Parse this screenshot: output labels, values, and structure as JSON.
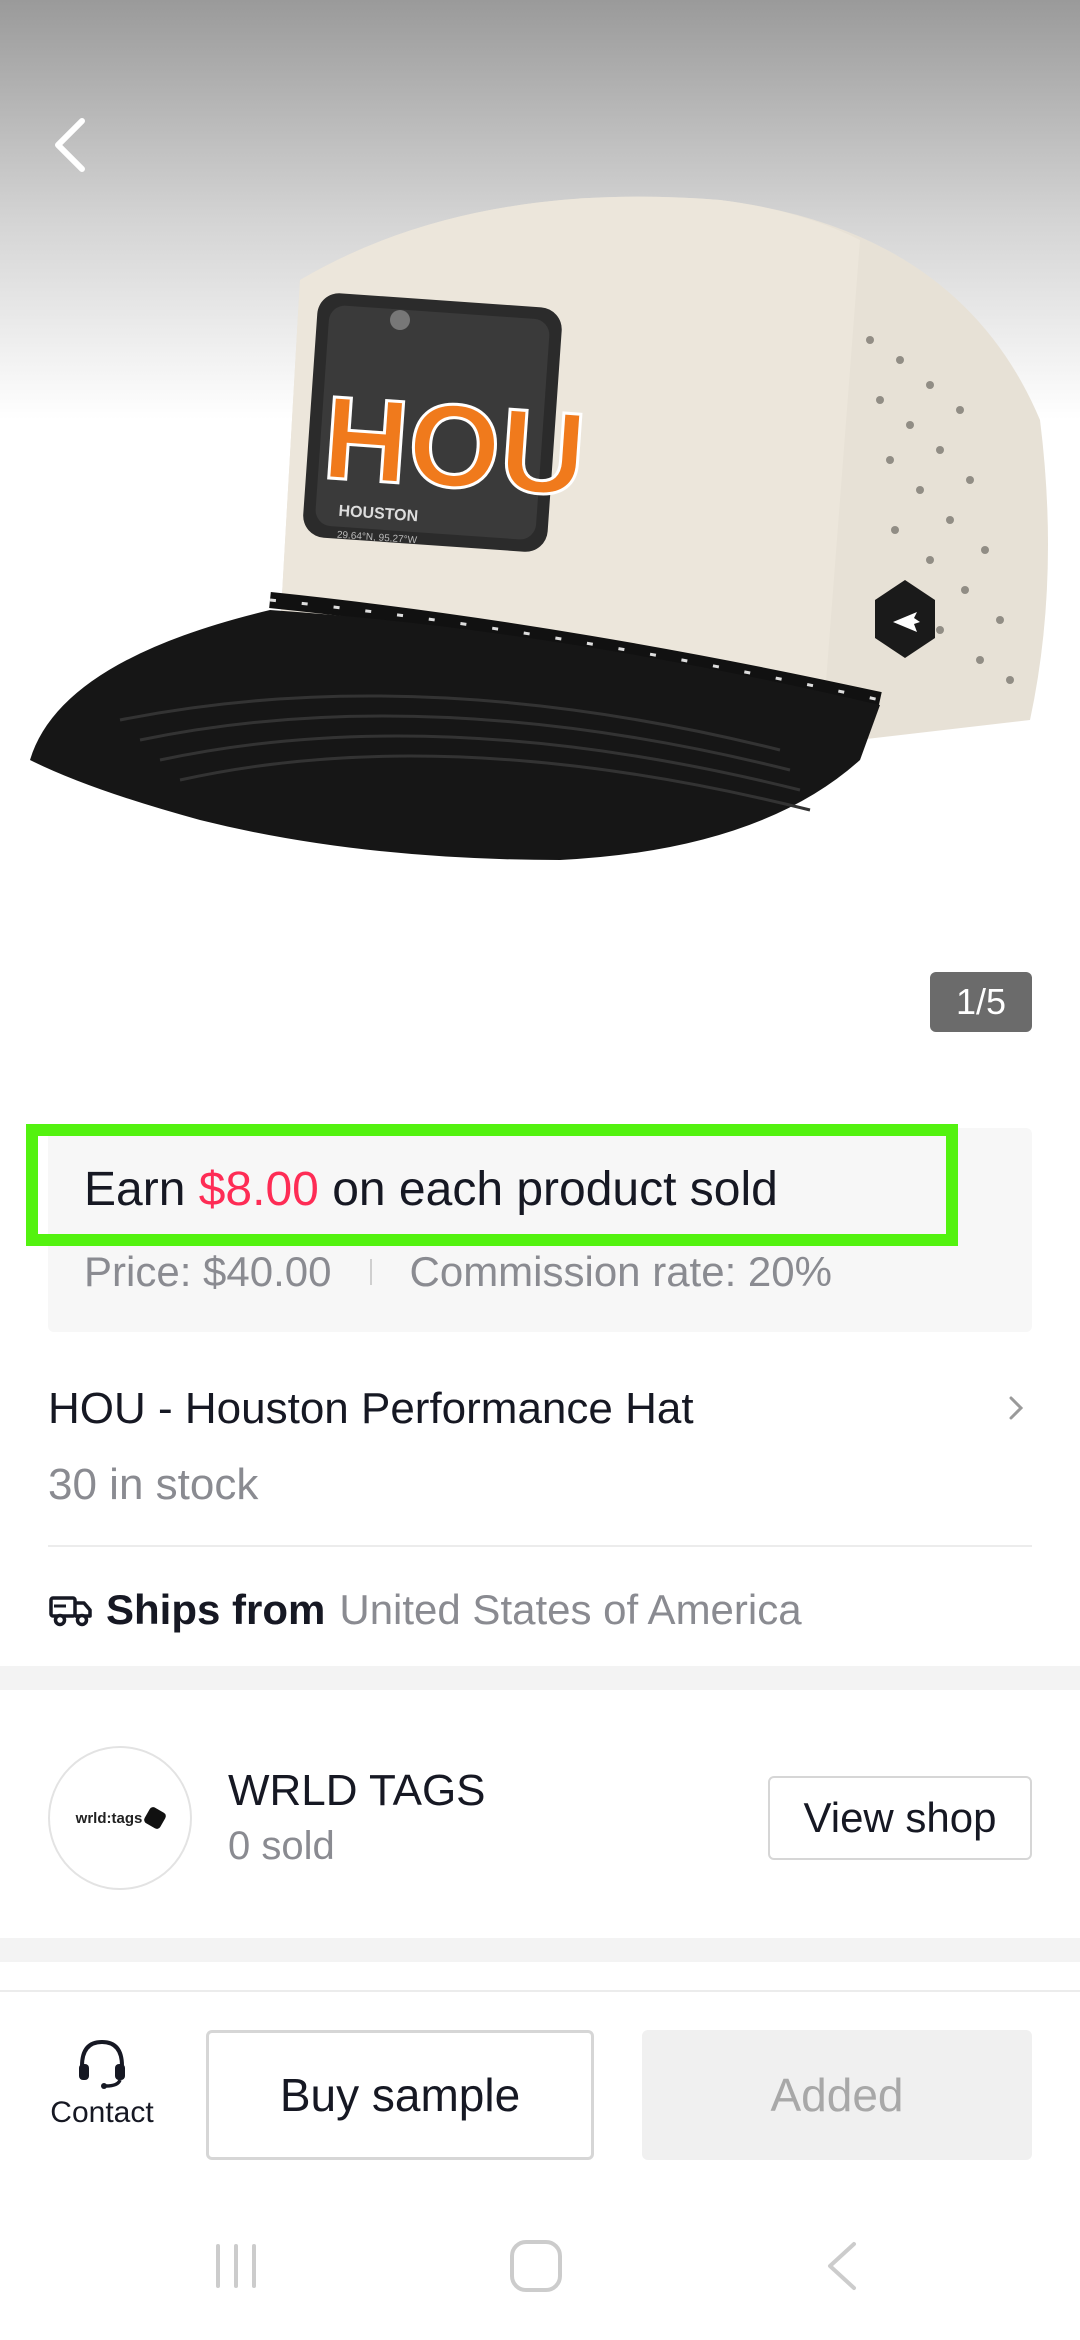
{
  "hero": {
    "page_indicator": "1/5",
    "hat_patch": {
      "big_text": "HOU",
      "small_text": "HOUSTON",
      "coords": "29.64°N, 95.27°W"
    }
  },
  "earnings": {
    "prefix": "Earn ",
    "amount": "$8.00",
    "suffix": " on each product sold",
    "price": "Price: $40.00",
    "commission": "Commission rate: 20%"
  },
  "product": {
    "title": "HOU - Houston Performance Hat",
    "stock": "30 in stock",
    "ships_label": "Ships from",
    "ships_value": "United States of America"
  },
  "shop": {
    "avatar_text": "wrld:tags",
    "name": "WRLD TAGS",
    "sold": "0 sold",
    "view_label": "View shop"
  },
  "bottom_bar": {
    "contact_label": "Contact",
    "buy_sample_label": "Buy sample",
    "added_label": "Added"
  },
  "colors": {
    "accent_red": "#fe2c55",
    "highlight_green": "#53f20f",
    "muted_text": "#8a8b91"
  },
  "icons": [
    "back-arrow-icon",
    "chevron-right-icon",
    "truck-icon",
    "headset-icon",
    "recent-apps-icon",
    "home-icon",
    "back-nav-icon"
  ]
}
